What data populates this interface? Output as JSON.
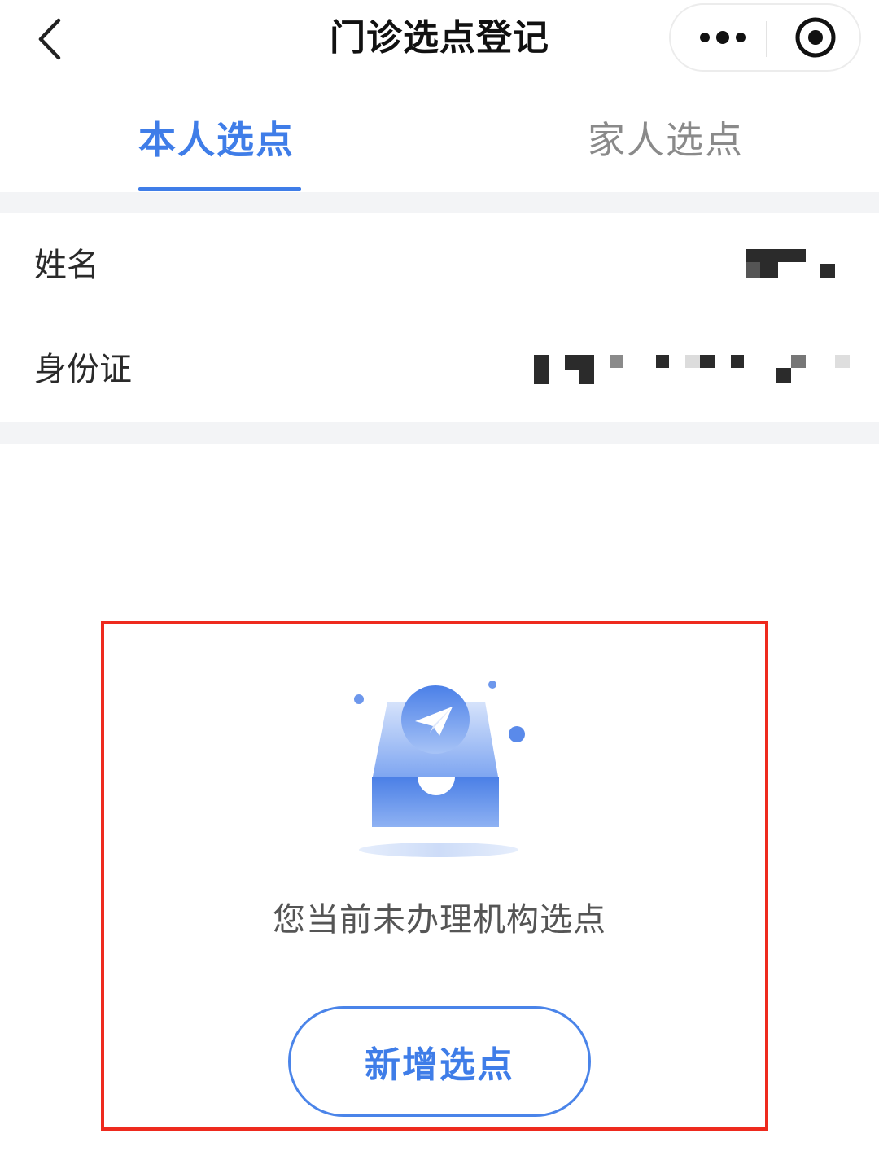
{
  "header": {
    "title": "门诊选点登记"
  },
  "tabs": [
    {
      "label": "本人选点",
      "active": true
    },
    {
      "label": "家人选点",
      "active": false
    }
  ],
  "info": {
    "name_label": "姓名",
    "id_label": "身份证"
  },
  "empty_state": {
    "message": "您当前未办理机构选点",
    "add_button_label": "新增选点"
  },
  "icons": {
    "back": "chevron-left-icon",
    "more": "more-dots-icon",
    "close": "target-circle-icon",
    "empty": "empty-box-paper-plane-icon"
  },
  "colors": {
    "accent": "#3f7de8",
    "highlight_border": "#ee2a1e",
    "inactive_tab": "#8a8a8a",
    "section_gap": "#f3f4f6"
  }
}
